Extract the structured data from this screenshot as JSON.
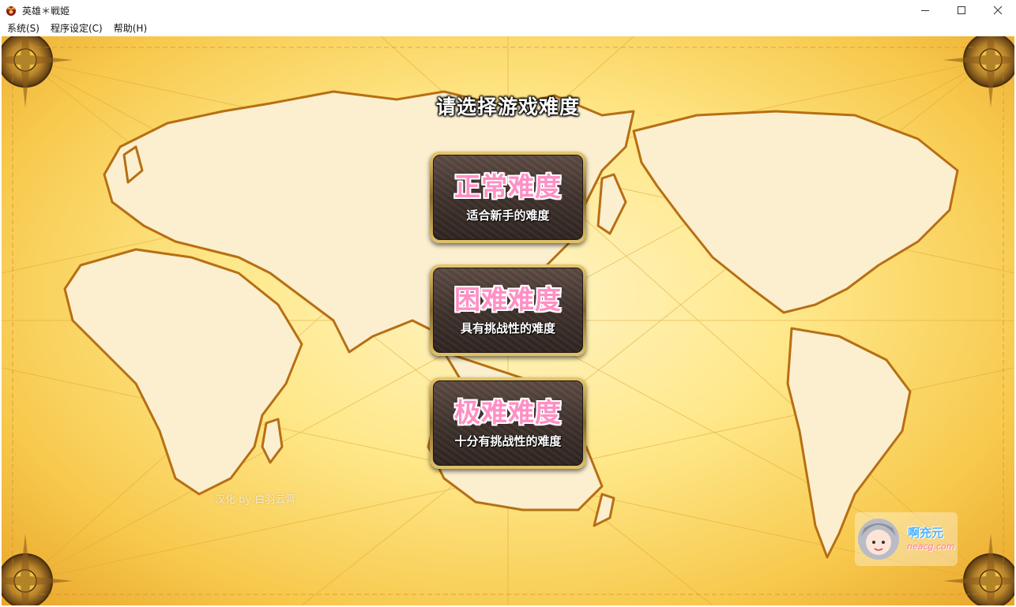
{
  "window": {
    "title": "英雄＊戦姫",
    "minimize_icon": "minimize-icon",
    "maximize_icon": "maximize-icon",
    "close_icon": "close-icon"
  },
  "menubar": {
    "items": [
      {
        "label": "系统(S)"
      },
      {
        "label": "程序设定(C)"
      },
      {
        "label": "帮助(H)"
      }
    ]
  },
  "game": {
    "prompt": "请选择游戏难度",
    "buttons": [
      {
        "title": "正常难度",
        "subtitle": "适合新手的难度"
      },
      {
        "title": "困难难度",
        "subtitle": "具有挑战性的难度"
      },
      {
        "title": "极难难度",
        "subtitle": "十分有挑战性的难度"
      }
    ],
    "watermark": "汉化 by 白羽云霄",
    "logo": {
      "name": "啊充元",
      "domain": "neacg.com"
    }
  },
  "colors": {
    "title_pink": "#ff8fc4",
    "button_dark": "#3f322d",
    "button_frame_gold": "#e6c86e",
    "map_yellow": "#ffe88a",
    "land": "#fbefcf"
  }
}
